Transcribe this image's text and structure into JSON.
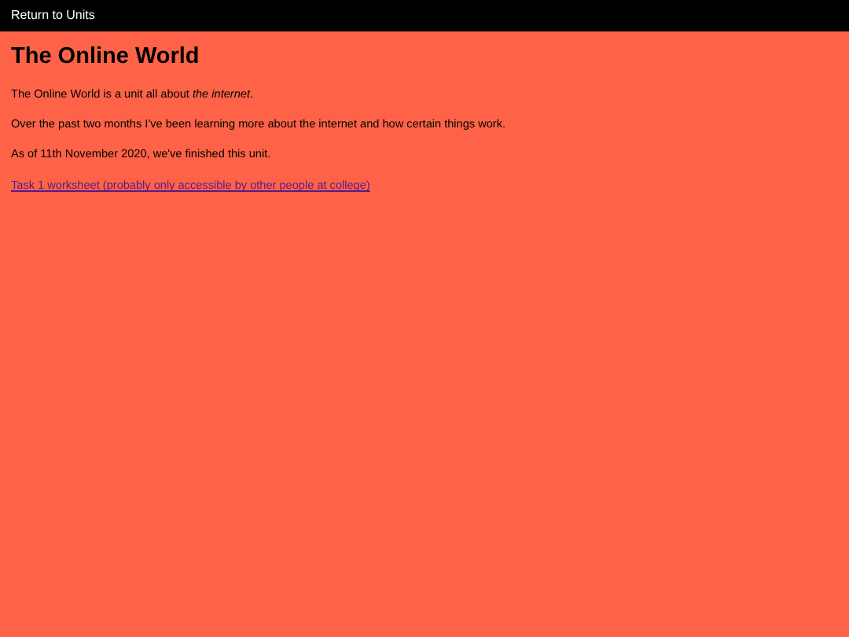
{
  "nav": {
    "link": "Return to Units"
  },
  "title": "The Online World",
  "paragraphs": [
    "The Online World is a unit all about *the internet*.",
    "Over the past two months I've been learning more about the internet and how certain things work.",
    "As of 11th November 2020, we've finished this unit."
  ],
  "link": "Task 1 worksheet (probably only accessible by other people at college)"
}
